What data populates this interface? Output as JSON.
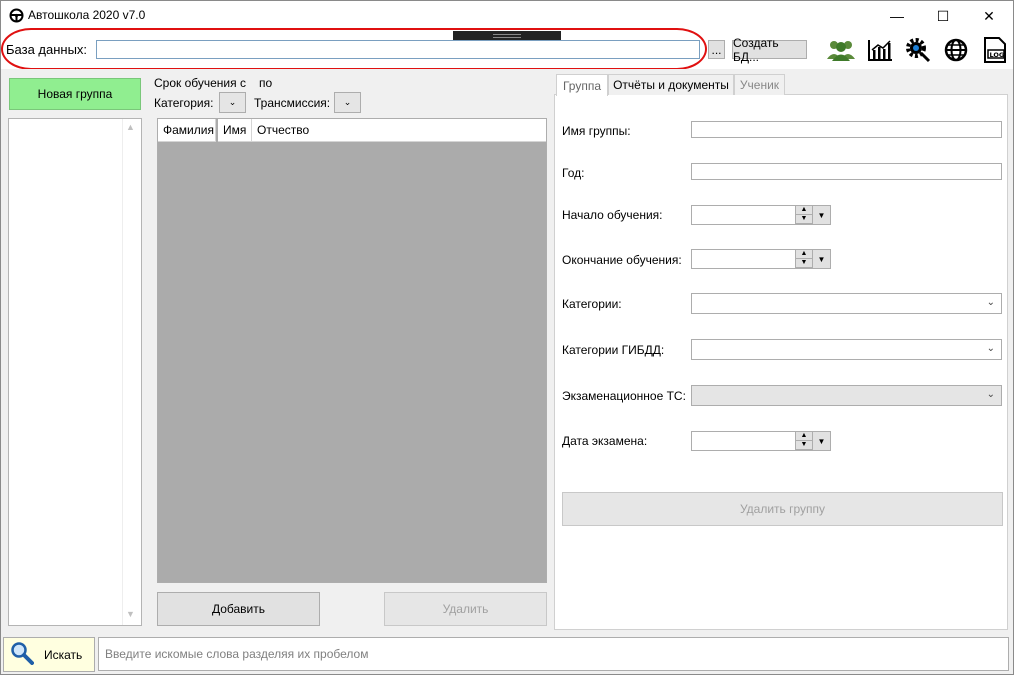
{
  "window": {
    "title": "Автошкола 2020 v7.0",
    "minimize": "—",
    "maximize": "☐",
    "close": "✕"
  },
  "topbar": {
    "db_label": "База данных:",
    "db_path": "",
    "browse_label": "...",
    "create_db_label": "Создать БД...",
    "icons": [
      "users-icon",
      "chart-icon",
      "settings-icon",
      "globe-icon",
      "log-icon"
    ],
    "log_icon_text": "LOG"
  },
  "left": {
    "new_group_label": "Новая группа"
  },
  "middle": {
    "period_label": "Срок обучения с",
    "period_to_label": "по",
    "category_label": "Категория:",
    "transmission_label": "Трансмиссия:",
    "columns": [
      "Фамилия",
      "Имя",
      "Отчество"
    ],
    "add_label": "Добавить",
    "delete_label": "Удалить"
  },
  "tabs": [
    {
      "label": "Группа",
      "active": true
    },
    {
      "label": "Отчёты и документы",
      "active": false
    },
    {
      "label": "Ученик",
      "active": false
    }
  ],
  "form": {
    "group_name_label": "Имя группы:",
    "year_label": "Год:",
    "start_label": "Начало обучения:",
    "end_label": "Окончание обучения:",
    "categories_label": "Категории:",
    "gibdd_label": "Категории ГИБДД:",
    "exam_vehicle_label": "Экзаменационное ТС:",
    "exam_date_label": "Дата экзамена:",
    "delete_group_label": "Удалить группу"
  },
  "bottom": {
    "search_label": "Искать",
    "search_placeholder": "Введите искомые слова разделяя их пробелом"
  },
  "colors": {
    "new_group_bg": "#90ee90",
    "highlight_oval": "#e01010",
    "search_btn_bg": "#ffffe0"
  }
}
